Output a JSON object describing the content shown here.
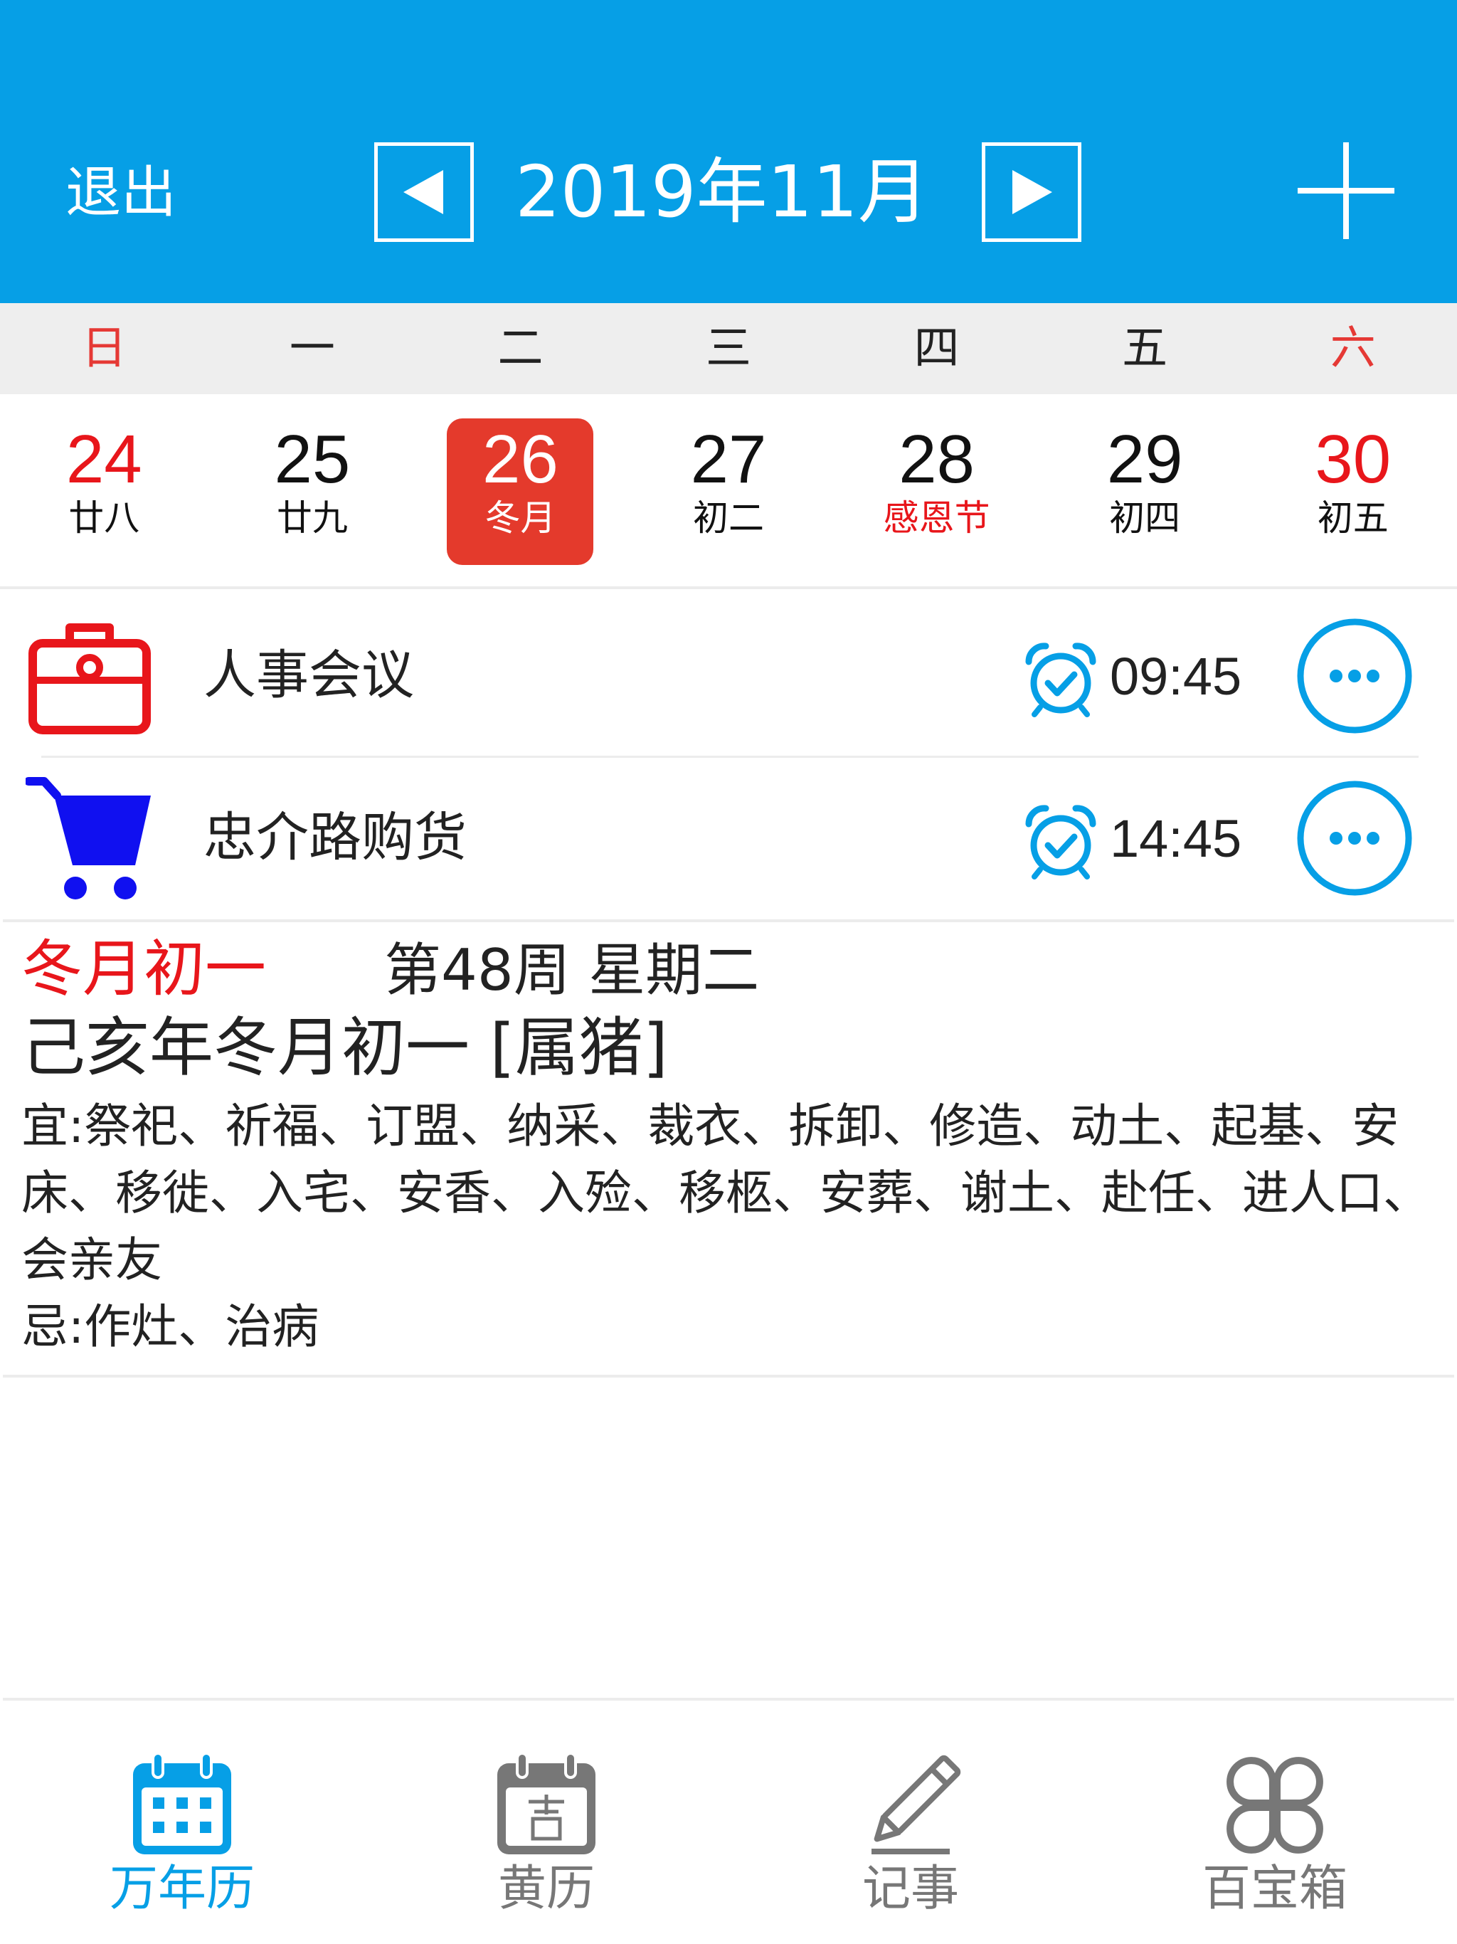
{
  "header": {
    "exit_label": "退出",
    "month_title": "2019年11月",
    "background_color": "#069fe6"
  },
  "weekdays": [
    "日",
    "一",
    "二",
    "三",
    "四",
    "五",
    "六"
  ],
  "week": [
    {
      "day": "24",
      "lunar": "廿八",
      "holiday": false,
      "weekend": true,
      "selected": false
    },
    {
      "day": "25",
      "lunar": "廿九",
      "holiday": false,
      "weekend": false,
      "selected": false
    },
    {
      "day": "26",
      "lunar": "冬月",
      "holiday": false,
      "weekend": false,
      "selected": true
    },
    {
      "day": "27",
      "lunar": "初二",
      "holiday": false,
      "weekend": false,
      "selected": false
    },
    {
      "day": "28",
      "lunar": "感恩节",
      "holiday": true,
      "weekend": false,
      "selected": false
    },
    {
      "day": "29",
      "lunar": "初四",
      "holiday": false,
      "weekend": false,
      "selected": false
    },
    {
      "day": "30",
      "lunar": "初五",
      "holiday": false,
      "weekend": true,
      "selected": false
    }
  ],
  "events": [
    {
      "title": "人事会议",
      "time": "09:45",
      "icon": "briefcase-icon"
    },
    {
      "title": "忠介路购货",
      "time": "14:45",
      "icon": "shopping-cart-icon"
    }
  ],
  "info": {
    "lunar_date": "冬月初一",
    "week_info": "第48周 星期二",
    "ganzhi": "己亥年冬月初一 [属猪]",
    "yi": "宜:祭祀、祈福、订盟、纳采、裁衣、拆卸、修造、动土、起基、安床、移徙、入宅、安香、入殓、移柩、安葬、谢土、赴任、进人口、会亲友",
    "ji": "忌:作灶、治病"
  },
  "tabs": [
    {
      "label": "万年历",
      "icon": "calendar-icon",
      "active": true
    },
    {
      "label": "黄历",
      "icon": "almanac-icon",
      "active": false
    },
    {
      "label": "记事",
      "icon": "pencil-icon",
      "active": false
    },
    {
      "label": "百宝箱",
      "icon": "clover-icon",
      "active": false
    }
  ],
  "colors": {
    "accent": "#069fe6",
    "selected_day": "#e43a2c",
    "red_text": "#e8161b",
    "event_briefcase": "#e8161b",
    "event_cart": "#1010f0"
  }
}
